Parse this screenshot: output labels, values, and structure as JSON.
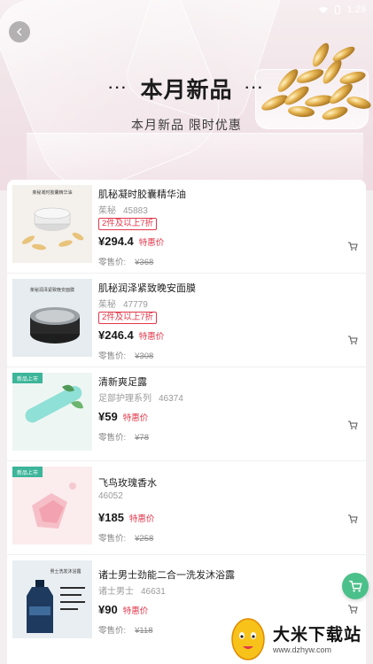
{
  "status_bar": {
    "time": "1:29"
  },
  "header": {
    "title": "本月新品",
    "title_dots_left": "···",
    "title_dots_right": "···",
    "subtitle": "本月新品 限时优惠"
  },
  "products": [
    {
      "name": "肌秘凝时胶囊精华油",
      "brand": "茱秘",
      "code": "45883",
      "promo": "2件及以上7折",
      "price": "¥294.4",
      "price_tag": "特惠价",
      "retail_label": "零售价:",
      "retail_price": "¥368",
      "thumb_text": "茱秘凝时胶囊精华油"
    },
    {
      "name": "肌秘润泽紧致晚安面膜",
      "brand": "茱秘",
      "code": "47779",
      "promo": "2件及以上7折",
      "price": "¥246.4",
      "price_tag": "特惠价",
      "retail_label": "零售价:",
      "retail_price": "¥308",
      "thumb_text": "茱秘润泽紧致晚安面膜"
    },
    {
      "name": "清新爽足露",
      "brand": "足部护理系列",
      "code": "46374",
      "promo": "",
      "price": "¥59",
      "price_tag": "特惠价",
      "retail_label": "零售价:",
      "retail_price": "¥78",
      "thumb_badge": "新品上市"
    },
    {
      "name": "飞鸟玫瑰香水",
      "brand": "",
      "code": "46052",
      "promo": "",
      "price": "¥185",
      "price_tag": "特惠价",
      "retail_label": "零售价:",
      "retail_price": "¥258",
      "thumb_badge": "新品上市"
    },
    {
      "name": "诸士男士劲能二合一洗发沐浴露",
      "brand": "诸士男士",
      "code": "46631",
      "promo": "",
      "price": "¥90",
      "price_tag": "特惠价",
      "retail_label": "零售价:",
      "retail_price": "¥118",
      "thumb_text": "男士洗发沐浴露"
    }
  ],
  "watermark": {
    "title": "大米下载站",
    "url": "www.dzhyw.com"
  },
  "colors": {
    "accent_red": "#e2364a",
    "cart_green": "#4cc08a",
    "hero_bg": "#f1e4e8"
  },
  "icons": {
    "back": "chevron-left-icon",
    "cart": "cart-icon",
    "float_cart": "floating-cart-icon",
    "battery": "battery-icon",
    "wifi": "wifi-icon"
  }
}
